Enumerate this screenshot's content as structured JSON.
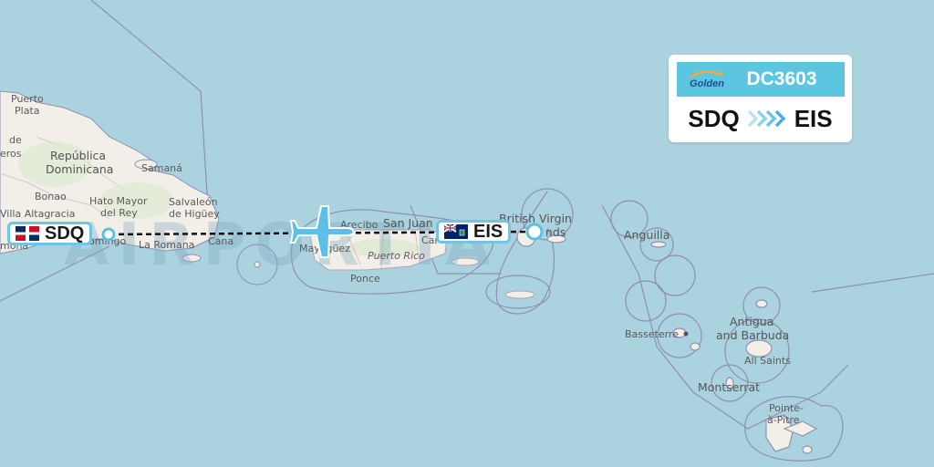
{
  "flight": {
    "airline_logo_text": "Golden",
    "number": "DC3603",
    "origin": "SDQ",
    "destination": "EIS"
  },
  "airports": {
    "origin_label": "SDQ",
    "destination_label": "EIS",
    "origin_flag": "dominican-republic-flag",
    "destination_flag": "british-virgin-islands-flag"
  },
  "watermark": "AIRPORTIA",
  "places": {
    "puerto_plata": "Puerto",
    "puerto_plata_2": "Plata",
    "republica": "República",
    "dominicana": "Dominicana",
    "samana": "Samaná",
    "de": "de",
    "eros": "eros",
    "bonao": "Bonao",
    "hato_mayor": "Hato Mayor",
    "del_rey": "del Rey",
    "salvaleon": "Salvaleón",
    "de_higuey": "de Higüey",
    "villa_altagracia": "Villa Altagracia",
    "domingo": "omingo",
    "la_romana": "La Romana",
    "cana": "Cana",
    "mona": "mona",
    "arecibo": "Arecibo",
    "san_juan": "San Juan",
    "mayaguez": "Mayagüez",
    "puerto_rico": "Puerto Rico",
    "ponce": "Ponce",
    "car": "Car",
    "bvi_1": "British Virgin",
    "bvi_2": "nds",
    "anguilla": "Anguilla",
    "basseterre": "Basseterre",
    "antigua": "Antigua",
    "and_barbuda": "and Barbuda",
    "all_saints": "All Saints",
    "montserrat": "Montserrat",
    "pointe": "Pointe-",
    "a_pitre": "à-Pitre"
  },
  "colors": {
    "sea": "#aad3df",
    "land": "#f2efe9",
    "border": "#9e7fb3",
    "accent": "#6fc6e3",
    "plane": "#5cc0e6"
  }
}
